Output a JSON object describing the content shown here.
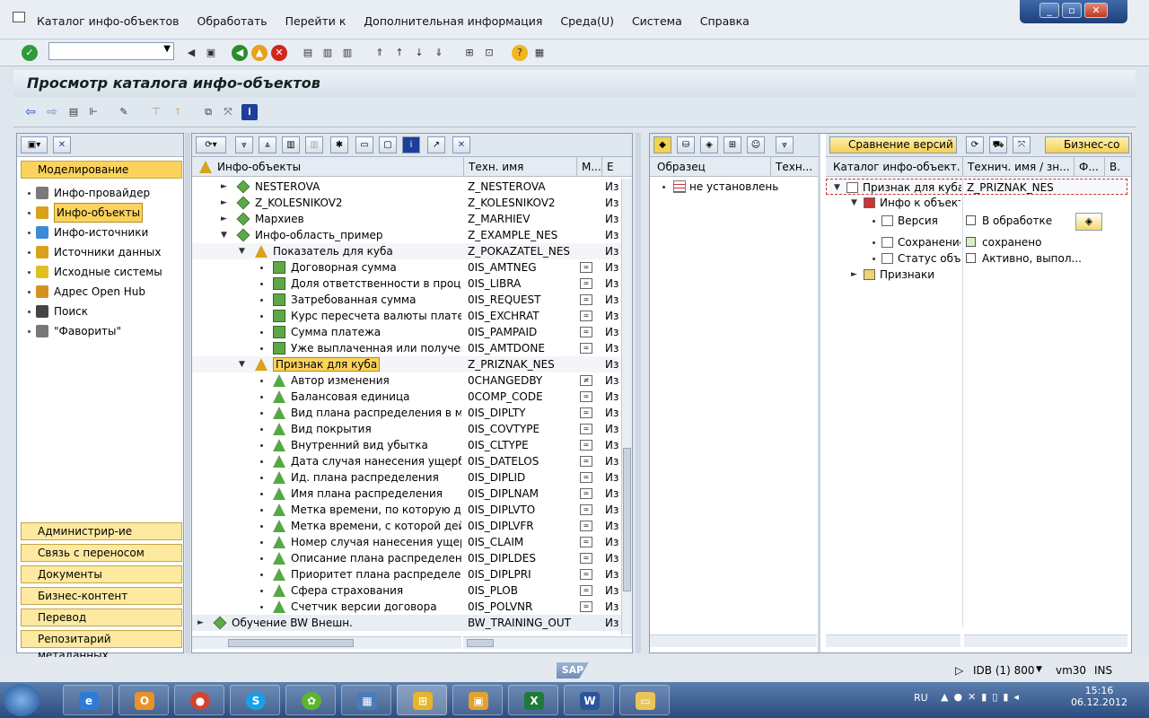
{
  "menu": {
    "items": [
      "Каталог инфо-объектов",
      "Обработать",
      "Перейти к",
      "Дополнительная информация",
      "Среда(U)",
      "Система",
      "Справка"
    ]
  },
  "page_title": "Просмотр каталога инфо-объектов",
  "left_nav": {
    "active_section": "Моделирование",
    "items": [
      "Инфо-провайдер",
      "Инфо-объекты",
      "Инфо-источники",
      "Источники данных",
      "Исходные системы",
      "Адрес Open Hub",
      "Поиск",
      "\"Фавориты\""
    ],
    "selected_item": "Инфо-объекты",
    "bottom_sections": [
      "Администрир-ие",
      "Связь с переносом",
      "Документы",
      "Бизнес-контент",
      "Перевод",
      "Репозитарий метаданных"
    ]
  },
  "mid_tree": {
    "columns": [
      "Инфо-объекты",
      "Техн. имя",
      "М...",
      "Е"
    ],
    "rows": [
      {
        "level": 1,
        "toggle": "►",
        "icon": "area",
        "name": "NESTEROVA",
        "tech": "Z_NESTEROVA",
        "mark": "",
        "stat": "Из"
      },
      {
        "level": 1,
        "toggle": "►",
        "icon": "area",
        "name": "Z_KOLESNIKOV2",
        "tech": "Z_KOLESNIKOV2",
        "mark": "",
        "stat": "Из"
      },
      {
        "level": 1,
        "toggle": "►",
        "icon": "area",
        "name": "Мархиев",
        "tech": "Z_MARHIEV",
        "mark": "",
        "stat": "Из"
      },
      {
        "level": 1,
        "toggle": "▼",
        "icon": "area",
        "name": "Инфо-область_пример",
        "tech": "Z_EXAMPLE_NES",
        "mark": "",
        "stat": "Из"
      },
      {
        "level": 2,
        "toggle": "▼",
        "icon": "catalog",
        "name": "Показатель для куба",
        "tech": "Z_POKAZATEL_NES",
        "mark": "",
        "stat": "Из"
      },
      {
        "level": 3,
        "toggle": "",
        "icon": "kf",
        "name": "Договорная сумма",
        "tech": "0IS_AMTNEG",
        "mark": "=",
        "stat": "Из"
      },
      {
        "level": 3,
        "toggle": "",
        "icon": "kf",
        "name": "Доля ответственности в процента",
        "tech": "0IS_LIBRA",
        "mark": "=",
        "stat": "Из"
      },
      {
        "level": 3,
        "toggle": "",
        "icon": "kf",
        "name": "Затребованная сумма",
        "tech": "0IS_REQUEST",
        "mark": "=",
        "stat": "Из"
      },
      {
        "level": 3,
        "toggle": "",
        "icon": "kf",
        "name": "Курс пересчета валюты платежа в",
        "tech": "0IS_EXCHRAT",
        "mark": "=",
        "stat": "Из"
      },
      {
        "level": 3,
        "toggle": "",
        "icon": "kf",
        "name": "Сумма платежа",
        "tech": "0IS_PAMPAID",
        "mark": "=",
        "stat": "Из"
      },
      {
        "level": 3,
        "toggle": "",
        "icon": "kf",
        "name": "Уже выплаченная или полученная",
        "tech": "0IS_AMTDONE",
        "mark": "=",
        "stat": "Из"
      },
      {
        "level": 2,
        "toggle": "▼",
        "icon": "catalog",
        "name": "Признак для куба",
        "tech": "Z_PRIZNAK_NES",
        "mark": "",
        "stat": "Из",
        "highlight": true
      },
      {
        "level": 3,
        "toggle": "",
        "icon": "ch",
        "name": "Автор изменения",
        "tech": "0CHANGEDBY",
        "mark": "≠",
        "stat": "Из"
      },
      {
        "level": 3,
        "toggle": "",
        "icon": "ch",
        "name": "Балансовая единица",
        "tech": "0COMP_CODE",
        "mark": "=",
        "stat": "Из"
      },
      {
        "level": 3,
        "toggle": "",
        "icon": "ch",
        "name": "Вид плана распределения в много",
        "tech": "0IS_DIPLTY",
        "mark": "=",
        "stat": "Из"
      },
      {
        "level": 3,
        "toggle": "",
        "icon": "ch",
        "name": "Вид покрытия",
        "tech": "0IS_COVTYPE",
        "mark": "=",
        "stat": "Из"
      },
      {
        "level": 3,
        "toggle": "",
        "icon": "ch",
        "name": "Внутренний вид убытка",
        "tech": "0IS_CLTYPE",
        "mark": "=",
        "stat": "Из"
      },
      {
        "level": 3,
        "toggle": "",
        "icon": "ch",
        "name": "Дата случая нанесения ущерба/вы",
        "tech": "0IS_DATELOS",
        "mark": "=",
        "stat": "Из"
      },
      {
        "level": 3,
        "toggle": "",
        "icon": "ch",
        "name": "Ид. плана распределения",
        "tech": "0IS_DIPLID",
        "mark": "=",
        "stat": "Из"
      },
      {
        "level": 3,
        "toggle": "",
        "icon": "ch",
        "name": "Имя плана распределения",
        "tech": "0IS_DIPLNAM",
        "mark": "=",
        "stat": "Из"
      },
      {
        "level": 3,
        "toggle": "",
        "icon": "ch",
        "name": "Метка времени, по которую дейст",
        "tech": "0IS_DIPLVTO",
        "mark": "=",
        "stat": "Из"
      },
      {
        "level": 3,
        "toggle": "",
        "icon": "ch",
        "name": "Метка времени, с которой действ",
        "tech": "0IS_DIPLVFR",
        "mark": "=",
        "stat": "Из"
      },
      {
        "level": 3,
        "toggle": "",
        "icon": "ch",
        "name": "Номер случая нанесения ущерба/(",
        "tech": "0IS_CLAIM",
        "mark": "=",
        "stat": "Из"
      },
      {
        "level": 3,
        "toggle": "",
        "icon": "ch",
        "name": "Описание плана распределения",
        "tech": "0IS_DIPLDES",
        "mark": "=",
        "stat": "Из"
      },
      {
        "level": 3,
        "toggle": "",
        "icon": "ch",
        "name": "Приоритет плана распределения",
        "tech": "0IS_DIPLPRI",
        "mark": "=",
        "stat": "Из"
      },
      {
        "level": 3,
        "toggle": "",
        "icon": "ch",
        "name": "Сфера страхования",
        "tech": "0IS_PLOB",
        "mark": "=",
        "stat": "Из"
      },
      {
        "level": 3,
        "toggle": "",
        "icon": "ch",
        "name": "Счетчик версии договора",
        "tech": "0IS_POLVNR",
        "mark": "=",
        "stat": "Из"
      },
      {
        "level": 0,
        "toggle": "►",
        "icon": "area",
        "name": "Обучение BW Внешн.",
        "tech": "BW_TRAINING_OUT",
        "mark": "",
        "stat": "Из"
      }
    ]
  },
  "sample_panel": {
    "columns": [
      "Образец",
      "Техн..."
    ],
    "rows": [
      "не установлень"
    ]
  },
  "detail_panel": {
    "toolbar_btn": "Сравнение версий",
    "toolbar_btn2": "Бизнес-со",
    "columns": [
      "Каталог инфо-объект.",
      "Технич. имя / зн...",
      "Ф...",
      "В."
    ],
    "rows": [
      {
        "name": "Признак для куба",
        "value": "Z_PRIZNAK_NES",
        "level": 0,
        "toggle": "▼"
      },
      {
        "name": "Инфо к объекту",
        "value": "",
        "level": 1,
        "toggle": "▼"
      },
      {
        "name": "Версия",
        "value": "В обработке",
        "level": 2,
        "toggle": ""
      },
      {
        "name": "Сохранение",
        "value": "сохранено",
        "level": 2,
        "toggle": ""
      },
      {
        "name": "Статус объекта",
        "value": "Активно, выпол...",
        "level": 2,
        "toggle": ""
      },
      {
        "name": "Признаки",
        "value": "",
        "level": 1,
        "toggle": "►"
      }
    ]
  },
  "status": {
    "system": "IDB (1) 800",
    "server": "vm30",
    "mode": "INS",
    "sap_logo": "SAP"
  },
  "taskbar": {
    "lang": "RU",
    "time": "15:16",
    "date": "06.12.2012"
  }
}
